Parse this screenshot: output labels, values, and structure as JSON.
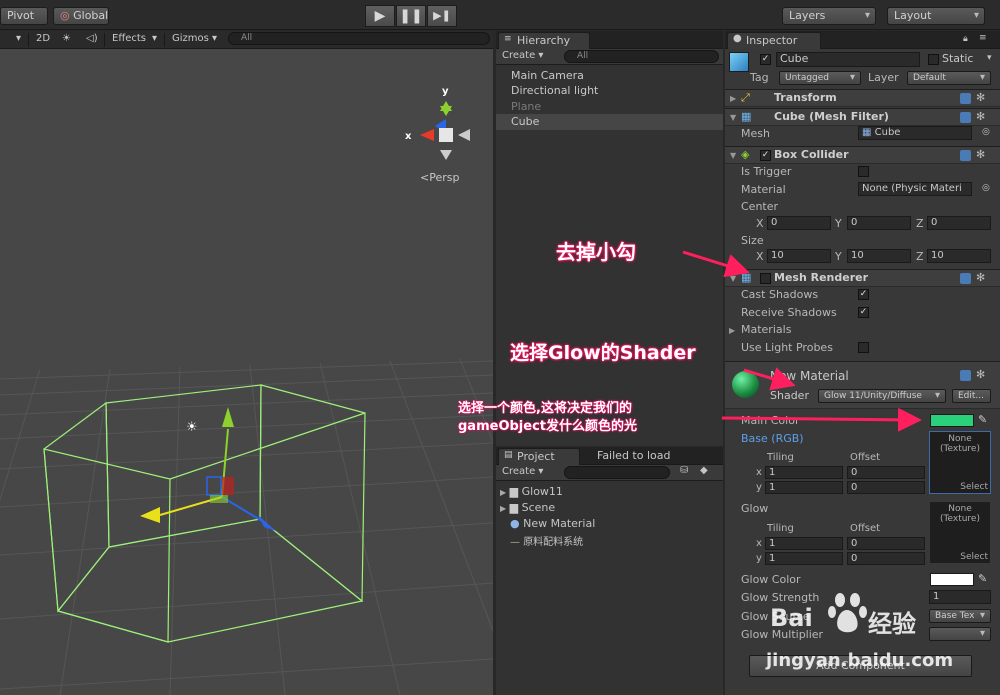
{
  "toolbar": {
    "pivot": "Pivot",
    "global": "Global",
    "play": "▶",
    "pause": "❚❚",
    "step": "▶❚",
    "layers": "Layers",
    "layout": "Layout"
  },
  "scene": {
    "mode_2d": "2D",
    "effects": "Effects",
    "gizmos": "Gizmos",
    "search_placeholder": "All",
    "axis_y": "y",
    "axis_x": "x",
    "persp": "Persp"
  },
  "hierarchy": {
    "tab": "Hierarchy",
    "create": "Create",
    "search_placeholder": "All",
    "items": [
      "Main Camera",
      "Directional light",
      "Plane",
      "Cube"
    ]
  },
  "project": {
    "tab": "Project",
    "tab2": "Failed to load",
    "create": "Create",
    "items": [
      "Glow11",
      "Scene",
      "New Material",
      "原料配料系统"
    ]
  },
  "inspector": {
    "tab": "Inspector",
    "object_name": "Cube",
    "static": "Static",
    "tag_label": "Tag",
    "tag_value": "Untagged",
    "layer_label": "Layer",
    "layer_value": "Default",
    "transform": "Transform",
    "mesh_filter": "Cube (Mesh Filter)",
    "mesh_label": "Mesh",
    "mesh_value": "Cube",
    "box_collider": "Box Collider",
    "is_trigger": "Is Trigger",
    "material_label": "Material",
    "material_value": "None (Physic Materi",
    "center_label": "Center",
    "center": {
      "x": "0",
      "y": "0",
      "z": "0"
    },
    "size_label": "Size",
    "size": {
      "x": "10",
      "y": "10",
      "z": "10"
    },
    "x_label": "X",
    "y_label": "Y",
    "z_label": "Z",
    "mesh_renderer": "Mesh Renderer",
    "cast_shadows": "Cast Shadows",
    "receive_shadows": "Receive Shadows",
    "materials": "Materials",
    "use_light_probes": "Use Light Probes",
    "new_material": "New Material",
    "shader_label": "Shader",
    "shader_value": "Glow 11/Unity/Diffuse",
    "edit": "Edit...",
    "main_color": "Main Color",
    "base_rgb": "Base (RGB)",
    "tiling": "Tiling",
    "offset": "Offset",
    "tex_none": "None",
    "tex_texture": "(Texture)",
    "select": "Select",
    "tiling_x": "1",
    "tiling_y": "1",
    "offset_x": "0",
    "offset_y": "0",
    "glow": "Glow",
    "glow_color": "Glow Color",
    "glow_strength": "Glow Strength",
    "glow_strength_value": "1",
    "glow_source": "Glow Source",
    "glow_source_value": "Base Tex",
    "glow_multiplier": "Glow Multiplier",
    "add_component": "Add Component",
    "main_color_hex": "#2ad17a",
    "glow_color_hex": "#ffffff"
  },
  "annotations": {
    "remove_check": "去掉小勾",
    "select_shader": "选择Glow的Shader",
    "select_color_line1": "选择一个颜色,这将决定我们的",
    "select_color_line2": "gameObject发什么颜色的光"
  },
  "watermark": {
    "brand": "Bai",
    "brand_cn": "经验",
    "url": "jingyan.baidu.com"
  },
  "colors": {
    "accent_pink": "#ff1f5e",
    "selection_blue": "#3d6ba8",
    "wire_green": "#9ef07a"
  }
}
